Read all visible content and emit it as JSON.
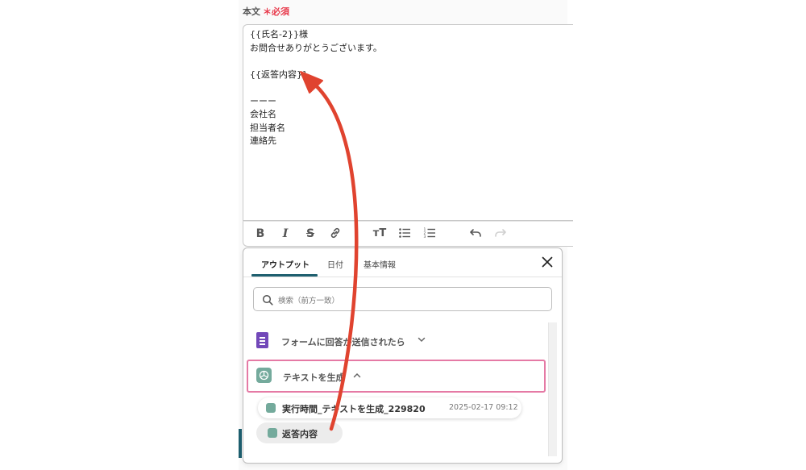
{
  "field": {
    "label": "本文",
    "required_mark": "＊",
    "required_text": "必須"
  },
  "editor": {
    "lines": [
      "{{氏名-2}}様",
      "お問合せありがとうございます。",
      "",
      "{{返答内容}}",
      "",
      "ーーー",
      "会社名",
      "担当者名",
      "連絡先"
    ]
  },
  "toolbar": {
    "icons": [
      "bold-icon",
      "italic-icon",
      "strikethrough-icon",
      "link-icon",
      "text-size-icon",
      "bullet-list-icon",
      "numbered-list-icon",
      "undo-icon",
      "redo-icon"
    ]
  },
  "popup": {
    "tabs": [
      {
        "label": "アウトプット",
        "active": true
      },
      {
        "label": "日付"
      },
      {
        "label": "基本情報"
      }
    ],
    "search": {
      "placeholder": "検索（前方一致）"
    },
    "nodes": [
      {
        "label": "フォームに回答が送信されたら",
        "icon": "google-forms-icon",
        "expanded": false
      },
      {
        "label": "テキストを生成",
        "icon": "chatgpt-icon",
        "expanded": true
      }
    ],
    "outputs": [
      {
        "label": "実行時間_テキストを生成_229820",
        "date": "2025-02-17 09:12"
      },
      {
        "label": "返答内容"
      }
    ]
  },
  "colors": {
    "accent": "#1e5f6f",
    "required": "#e8394b",
    "highlight_border": "#e57aa5",
    "arrow": "#e0432f"
  }
}
